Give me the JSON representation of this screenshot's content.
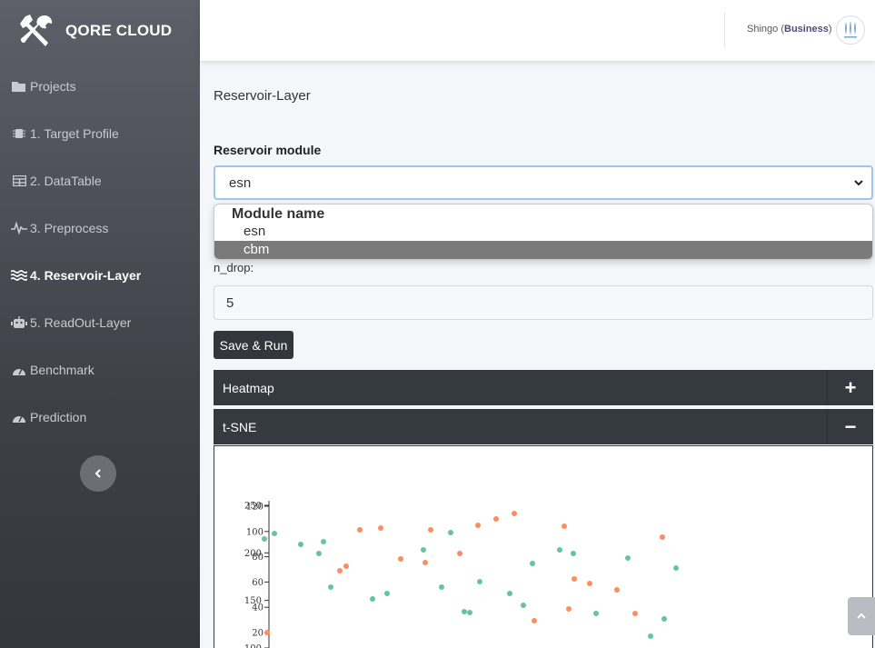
{
  "brand": {
    "name": "QORE CLOUD"
  },
  "sidebar": {
    "items": [
      {
        "label": "Projects",
        "icon": "folder-icon",
        "active": false
      },
      {
        "label": "1. Target Profile",
        "icon": "chip-icon",
        "active": false
      },
      {
        "label": "2. DataTable",
        "icon": "table-icon",
        "active": false
      },
      {
        "label": "3. Preprocess",
        "icon": "pulse-icon",
        "active": false
      },
      {
        "label": "4. Reservoir-Layer",
        "icon": "water-icon",
        "active": true
      },
      {
        "label": "5. ReadOut-Layer",
        "icon": "robot-icon",
        "active": false
      },
      {
        "label": "Benchmark",
        "icon": "gauge-icon",
        "active": false
      },
      {
        "label": "Prediction",
        "icon": "gauge-icon",
        "active": false
      }
    ]
  },
  "header": {
    "user_name": "Shingo",
    "plan": "Business"
  },
  "main": {
    "title": "Reservoir-Layer",
    "module_label": "Reservoir module",
    "module_value": "esn",
    "dropdown": {
      "group": "Module name",
      "options": [
        "esn",
        "cbm"
      ],
      "highlighted": "cbm"
    },
    "ndrop_label": "n_drop:",
    "ndrop_value": "5",
    "save_label": "Save & Run",
    "panels": [
      {
        "title": "Heatmap",
        "toggle": "+"
      },
      {
        "title": "t-SNE",
        "toggle": "−"
      }
    ]
  },
  "colors": {
    "series_a": "#66c2a5",
    "series_b": "#fc8d62",
    "dark": "#343a40"
  },
  "chart_data": {
    "type": "scatter",
    "axes": [
      {
        "name": "left",
        "ticks": [
          20,
          40,
          60,
          80,
          100,
          120
        ]
      },
      {
        "name": "overlay",
        "ticks": [
          100,
          150,
          200,
          250
        ]
      }
    ],
    "series": [
      {
        "color": "#66c2a5",
        "points": [
          [
            -5,
            120
          ],
          [
            6,
            126
          ],
          [
            35,
            114
          ],
          [
            55,
            104
          ],
          [
            60,
            117
          ],
          [
            68,
            67
          ],
          [
            114,
            54
          ],
          [
            130,
            60
          ],
          [
            170,
            108
          ],
          [
            190,
            67
          ],
          [
            200,
            127
          ],
          [
            215,
            40
          ],
          [
            221,
            39
          ],
          [
            232,
            73
          ],
          [
            265,
            60
          ],
          [
            280,
            47
          ],
          [
            290,
            93
          ],
          [
            320,
            108
          ],
          [
            335,
            104
          ],
          [
            360,
            38
          ],
          [
            395,
            99
          ],
          [
            420,
            13
          ],
          [
            435,
            32
          ],
          [
            448,
            88
          ]
        ]
      },
      {
        "color": "#fc8d62",
        "points": [
          [
            -2,
            17
          ],
          [
            78,
            85
          ],
          [
            85,
            90
          ],
          [
            100,
            130
          ],
          [
            123,
            132
          ],
          [
            145,
            98
          ],
          [
            172,
            94
          ],
          [
            178,
            130
          ],
          [
            210,
            104
          ],
          [
            230,
            135
          ],
          [
            250,
            142
          ],
          [
            270,
            148
          ],
          [
            292,
            30
          ],
          [
            325,
            134
          ],
          [
            330,
            43
          ],
          [
            336,
            76
          ],
          [
            353,
            71
          ],
          [
            383,
            64
          ],
          [
            403,
            38
          ],
          [
            433,
            122
          ]
        ]
      }
    ]
  }
}
